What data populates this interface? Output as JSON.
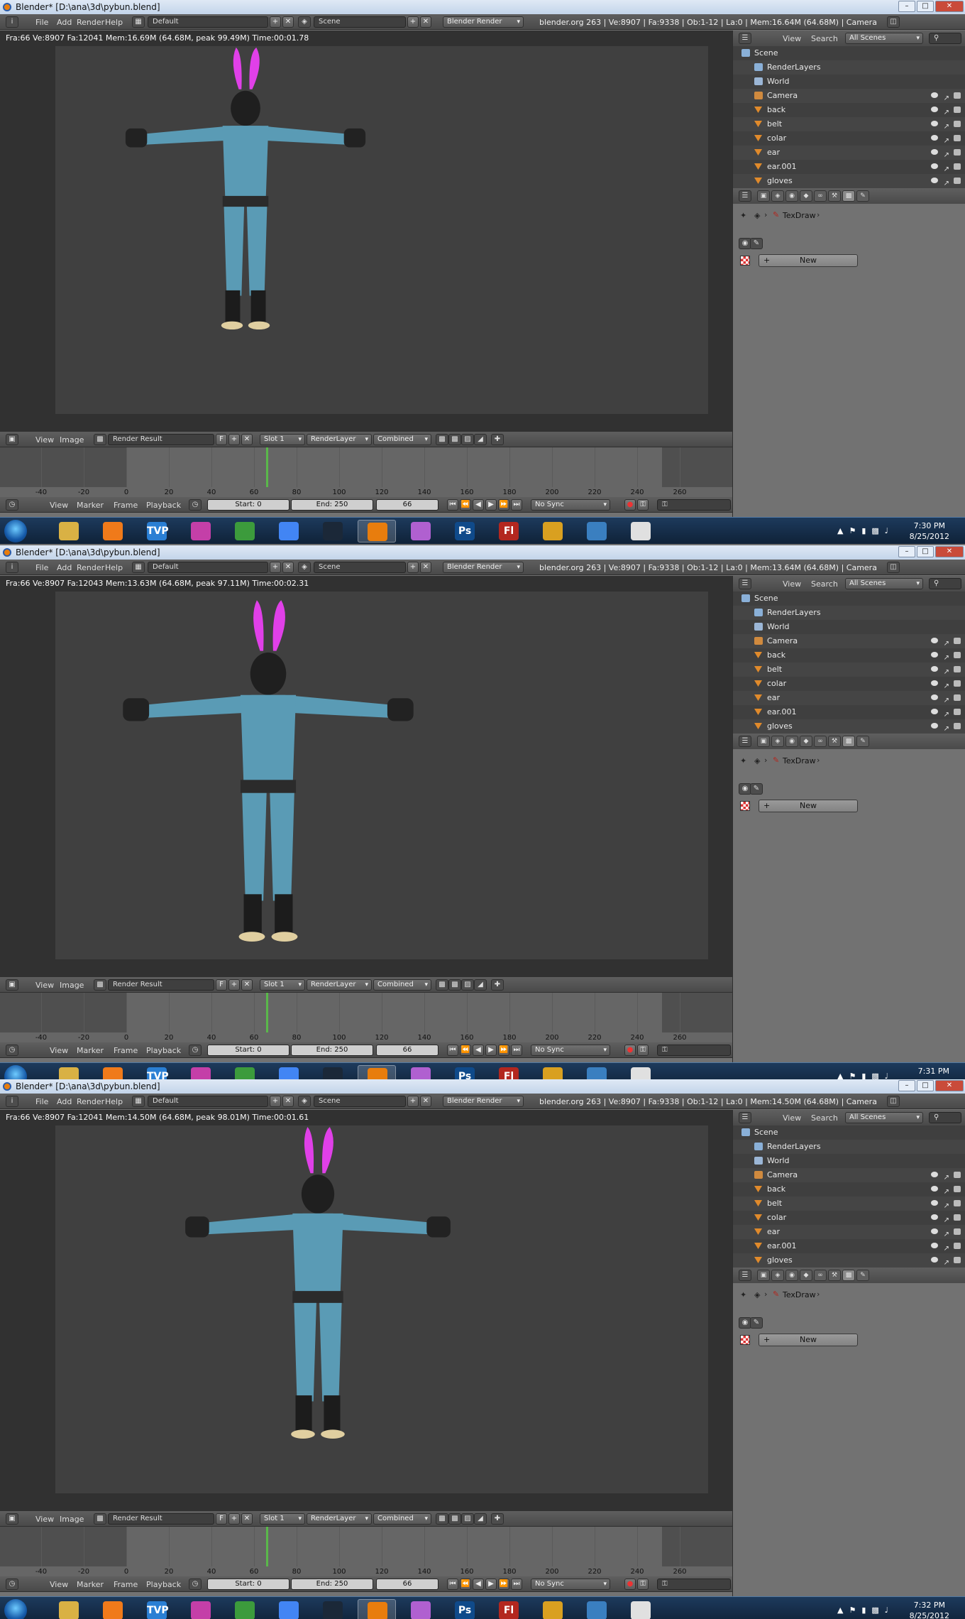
{
  "shots": [
    {
      "title": "Blender* [D:\\ana\\3d\\pybun.blend]",
      "menus": [
        "File",
        "Add",
        "Render",
        "Help"
      ],
      "layout": "Default",
      "scene": "Scene",
      "engine": "Blender Render",
      "stats": "blender.org 263 | Ve:8907 | Fa:9338 | Ob:1-12 | La:0 | Mem:16.64M (64.68M) | Camera",
      "render_info": "Fra:66  Ve:8907 Fa:12041 Mem:16.69M (64.68M, peak 99.49M) Time:00:01.78",
      "clock_time": "7:30 PM",
      "clock_date": "8/25/2012",
      "view": "front"
    },
    {
      "title": "Blender* [D:\\ana\\3d\\pybun.blend]",
      "menus": [
        "File",
        "Add",
        "Render",
        "Help"
      ],
      "layout": "Default",
      "scene": "Scene",
      "engine": "Blender Render",
      "stats": "blender.org 263 | Ve:8907 | Fa:9338 | Ob:1-12 | La:0 | Mem:13.64M (64.68M) | Camera",
      "render_info": "Fra:66  Ve:8907 Fa:12043 Mem:13.63M (64.68M, peak 97.11M) Time:00:02.31",
      "clock_time": "7:31 PM",
      "clock_date": "",
      "view": "back-low"
    },
    {
      "title": "Blender* [D:\\ana\\3d\\pybun.blend]",
      "menus": [
        "File",
        "Add",
        "Render",
        "Help"
      ],
      "layout": "Default",
      "scene": "Scene",
      "engine": "Blender Render",
      "stats": "blender.org 263 | Ve:8907 | Fa:9338 | Ob:1-12 | La:0 | Mem:14.50M (64.68M) | Camera",
      "render_info": "Fra:66  Ve:8907 Fa:12041 Mem:14.50M (64.68M, peak 98.01M) Time:00:01.61",
      "clock_time": "7:32 PM",
      "clock_date": "8/25/2012",
      "view": "back-side"
    }
  ],
  "outliner": {
    "view": "View",
    "search": "Search",
    "filter": "All Scenes",
    "items": [
      "Scene",
      "RenderLayers",
      "World",
      "Camera",
      "back",
      "belt",
      "colar",
      "ear",
      "ear.001",
      "gloves"
    ]
  },
  "properties": {
    "brush": "TexDraw",
    "new_button": "New"
  },
  "image_editor": {
    "menus": [
      "View",
      "Image"
    ],
    "image": "Render Result",
    "f_label": "F",
    "slot": "Slot 1",
    "layer": "RenderLayer",
    "pass": "Combined"
  },
  "timeline": {
    "menus": [
      "View",
      "Marker",
      "Frame",
      "Playback"
    ],
    "start": "Start: 0",
    "end": "End: 250",
    "current": "66",
    "sync": "No Sync",
    "ticks": [
      "-40",
      "-20",
      "0",
      "20",
      "40",
      "60",
      "80",
      "100",
      "120",
      "140",
      "160",
      "180",
      "200",
      "220",
      "240",
      "260"
    ],
    "current_frame": 66
  },
  "colors": {
    "suit": "#5a9bb5",
    "ears": "#e040e8",
    "timeline_cursor": "#5ab84a"
  },
  "taskbar_icons": [
    "files-icon",
    "media-player-icon",
    "tvp-icon",
    "paint-icon",
    "game-icon",
    "chrome-icon",
    "steam-icon",
    "blender-icon",
    "color-wheel-icon",
    "photoshop-icon",
    "flash-icon",
    "puzzle-icon",
    "screen-icon",
    "painter-icon"
  ],
  "taskbar_labels": {
    "photoshop": "Ps",
    "flash": "Fl",
    "tvp": "TVP"
  }
}
